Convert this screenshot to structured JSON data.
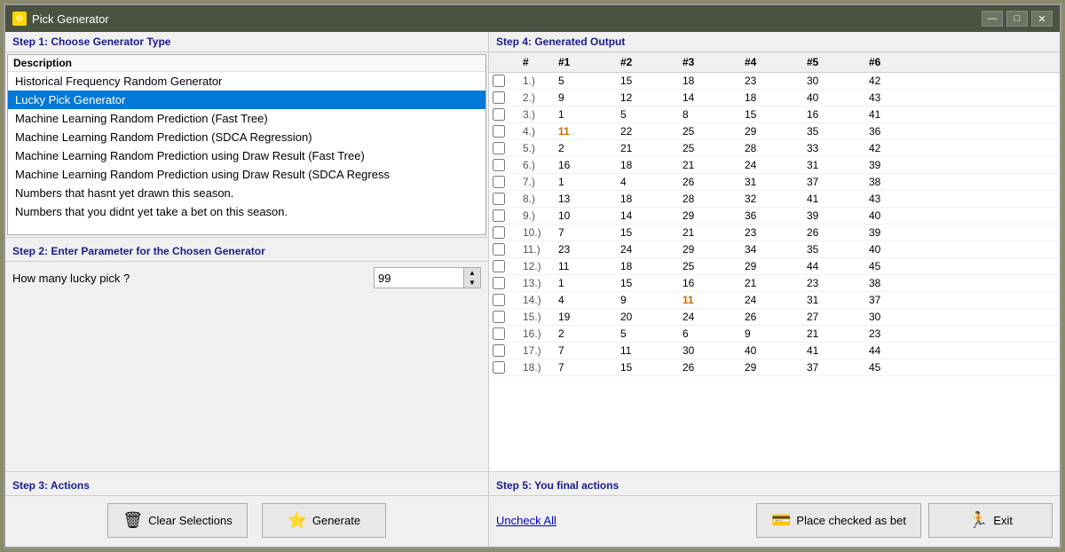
{
  "window": {
    "title": "Pick Generator",
    "icon": "★"
  },
  "titlebar": {
    "minimize": "—",
    "maximize": "□",
    "close": "✕"
  },
  "step1": {
    "label": "Step 1: Choose Generator Type",
    "column_header": "Description",
    "items": [
      "Historical Frequency Random Generator",
      "Lucky Pick Generator",
      "Machine Learning Random Prediction (Fast Tree)",
      "Machine Learning Random Prediction (SDCA Regression)",
      "Machine Learning Random Prediction using Draw Result (Fast Tree)",
      "Machine Learning Random Prediction using Draw Result (SDCA Regress",
      "Numbers that hasnt yet drawn this season.",
      "Numbers that you didnt yet take a bet on this season."
    ],
    "selected_index": 1
  },
  "step2": {
    "label": "Step 2: Enter Parameter for the Chosen Generator",
    "param_label": "How many lucky pick ?",
    "param_value": "99"
  },
  "step3": {
    "label": "Step 3: Actions",
    "clear_label": "Clear Selections",
    "generate_label": "Generate"
  },
  "step4": {
    "label": "Step 4: Generated Output",
    "columns": [
      "#",
      "#1",
      "#2",
      "#3",
      "#4",
      "#5",
      "#6"
    ],
    "rows": [
      {
        "num": "1.)",
        "v1": "5",
        "v2": "15",
        "v3": "18",
        "v4": "23",
        "v5": "30",
        "v6": "42",
        "highlight": []
      },
      {
        "num": "2.)",
        "v1": "9",
        "v2": "12",
        "v3": "14",
        "v4": "18",
        "v5": "40",
        "v6": "43",
        "highlight": []
      },
      {
        "num": "3.)",
        "v1": "1",
        "v2": "5",
        "v3": "8",
        "v4": "15",
        "v5": "16",
        "v6": "41",
        "highlight": []
      },
      {
        "num": "4.)",
        "v1": "11",
        "v2": "22",
        "v3": "25",
        "v4": "29",
        "v5": "35",
        "v6": "36",
        "highlight": [
          1
        ]
      },
      {
        "num": "5.)",
        "v1": "2",
        "v2": "21",
        "v3": "25",
        "v4": "28",
        "v5": "33",
        "v6": "42",
        "highlight": []
      },
      {
        "num": "6.)",
        "v1": "16",
        "v2": "18",
        "v3": "21",
        "v4": "24",
        "v5": "31",
        "v6": "39",
        "highlight": []
      },
      {
        "num": "7.)",
        "v1": "1",
        "v2": "4",
        "v3": "26",
        "v4": "31",
        "v5": "37",
        "v6": "38",
        "highlight": []
      },
      {
        "num": "8.)",
        "v1": "13",
        "v2": "18",
        "v3": "28",
        "v4": "32",
        "v5": "41",
        "v6": "43",
        "highlight": []
      },
      {
        "num": "9.)",
        "v1": "10",
        "v2": "14",
        "v3": "29",
        "v4": "36",
        "v5": "39",
        "v6": "40",
        "highlight": []
      },
      {
        "num": "10.)",
        "v1": "7",
        "v2": "15",
        "v3": "21",
        "v4": "23",
        "v5": "26",
        "v6": "39",
        "highlight": []
      },
      {
        "num": "11.)",
        "v1": "23",
        "v2": "24",
        "v3": "29",
        "v4": "34",
        "v5": "35",
        "v6": "40",
        "highlight": []
      },
      {
        "num": "12.)",
        "v1": "11",
        "v2": "18",
        "v3": "25",
        "v4": "29",
        "v5": "44",
        "v6": "45",
        "highlight": []
      },
      {
        "num": "13.)",
        "v1": "1",
        "v2": "15",
        "v3": "16",
        "v4": "21",
        "v5": "23",
        "v6": "38",
        "highlight": []
      },
      {
        "num": "14.)",
        "v1": "4",
        "v2": "9",
        "v3": "11",
        "v4": "24",
        "v5": "31",
        "v6": "37",
        "highlight": [
          3
        ]
      },
      {
        "num": "15.)",
        "v1": "19",
        "v2": "20",
        "v3": "24",
        "v4": "26",
        "v5": "27",
        "v6": "30",
        "highlight": []
      },
      {
        "num": "16.)",
        "v1": "2",
        "v2": "5",
        "v3": "6",
        "v4": "9",
        "v5": "21",
        "v6": "23",
        "highlight": []
      },
      {
        "num": "17.)",
        "v1": "7",
        "v2": "11",
        "v3": "30",
        "v4": "40",
        "v5": "41",
        "v6": "44",
        "highlight": []
      },
      {
        "num": "18.)",
        "v1": "7",
        "v2": "15",
        "v3": "26",
        "v4": "29",
        "v5": "37",
        "v6": "45",
        "highlight": []
      }
    ]
  },
  "step5": {
    "label": "Step 5: You final actions",
    "uncheck_all": "Uncheck All",
    "place_bet_label": "Place checked as bet",
    "exit_label": "Exit"
  }
}
